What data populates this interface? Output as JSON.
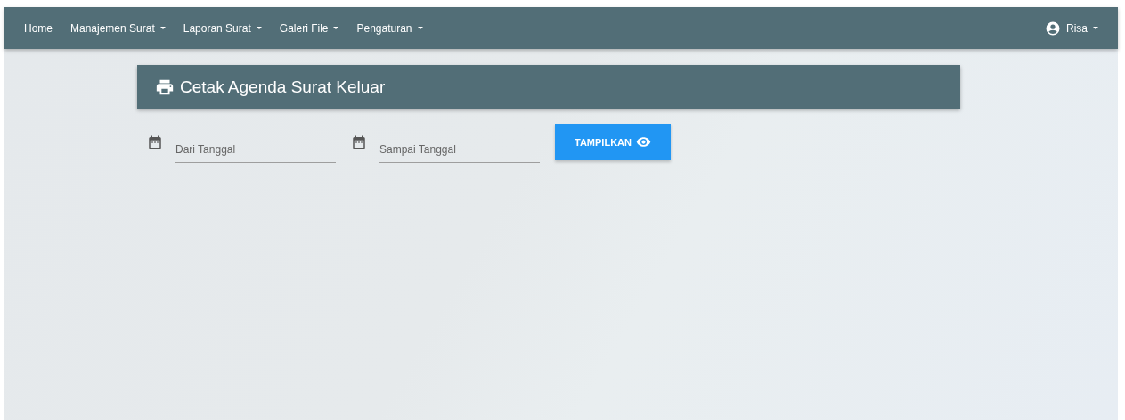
{
  "navbar": {
    "items": [
      {
        "label": "Home",
        "dropdown": false
      },
      {
        "label": "Manajemen Surat",
        "dropdown": true
      },
      {
        "label": "Laporan Surat",
        "dropdown": true
      },
      {
        "label": "Galeri File",
        "dropdown": true
      },
      {
        "label": "Pengaturan",
        "dropdown": true
      }
    ],
    "user": {
      "label": "Risa",
      "dropdown": true
    }
  },
  "header": {
    "title": "Cetak Agenda Surat Keluar"
  },
  "form": {
    "fields": [
      {
        "placeholder": "Dari Tanggal"
      },
      {
        "placeholder": "Sampai Tanggal"
      }
    ],
    "button": {
      "label": "TAMPILKAN"
    }
  }
}
